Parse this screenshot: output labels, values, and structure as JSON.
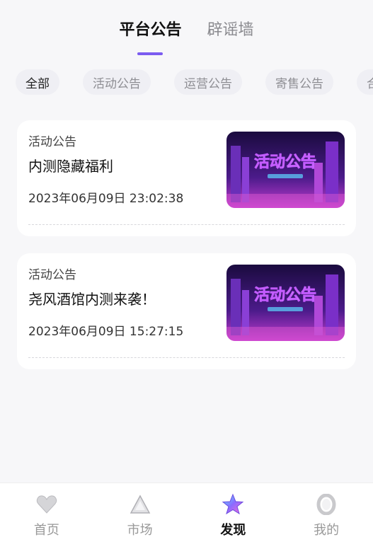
{
  "top_tabs": [
    {
      "label": "平台公告",
      "active": true
    },
    {
      "label": "辟谣墙",
      "active": false
    }
  ],
  "filters": [
    {
      "label": "全部",
      "active": true
    },
    {
      "label": "活动公告",
      "active": false
    },
    {
      "label": "运营公告",
      "active": false
    },
    {
      "label": "寄售公告",
      "active": false
    },
    {
      "label": "合",
      "active": false
    }
  ],
  "announcements": [
    {
      "category": "活动公告",
      "title": "内测隐藏福利",
      "time": "2023年06月09日 23:02:38",
      "image_text": "活动公告"
    },
    {
      "category": "活动公告",
      "title": "尧风酒馆内测来袭！",
      "time": "2023年06月09日 15:27:15",
      "image_text": "活动公告"
    }
  ],
  "bottom_nav": [
    {
      "label": "首页",
      "icon": "heart-icon"
    },
    {
      "label": "市场",
      "icon": "triangle-icon"
    },
    {
      "label": "发现",
      "icon": "star-icon",
      "active": true
    },
    {
      "label": "我的",
      "icon": "ring-icon"
    }
  ],
  "colors": {
    "accent": "#7b5cf0",
    "background": "#f7f7f9"
  }
}
